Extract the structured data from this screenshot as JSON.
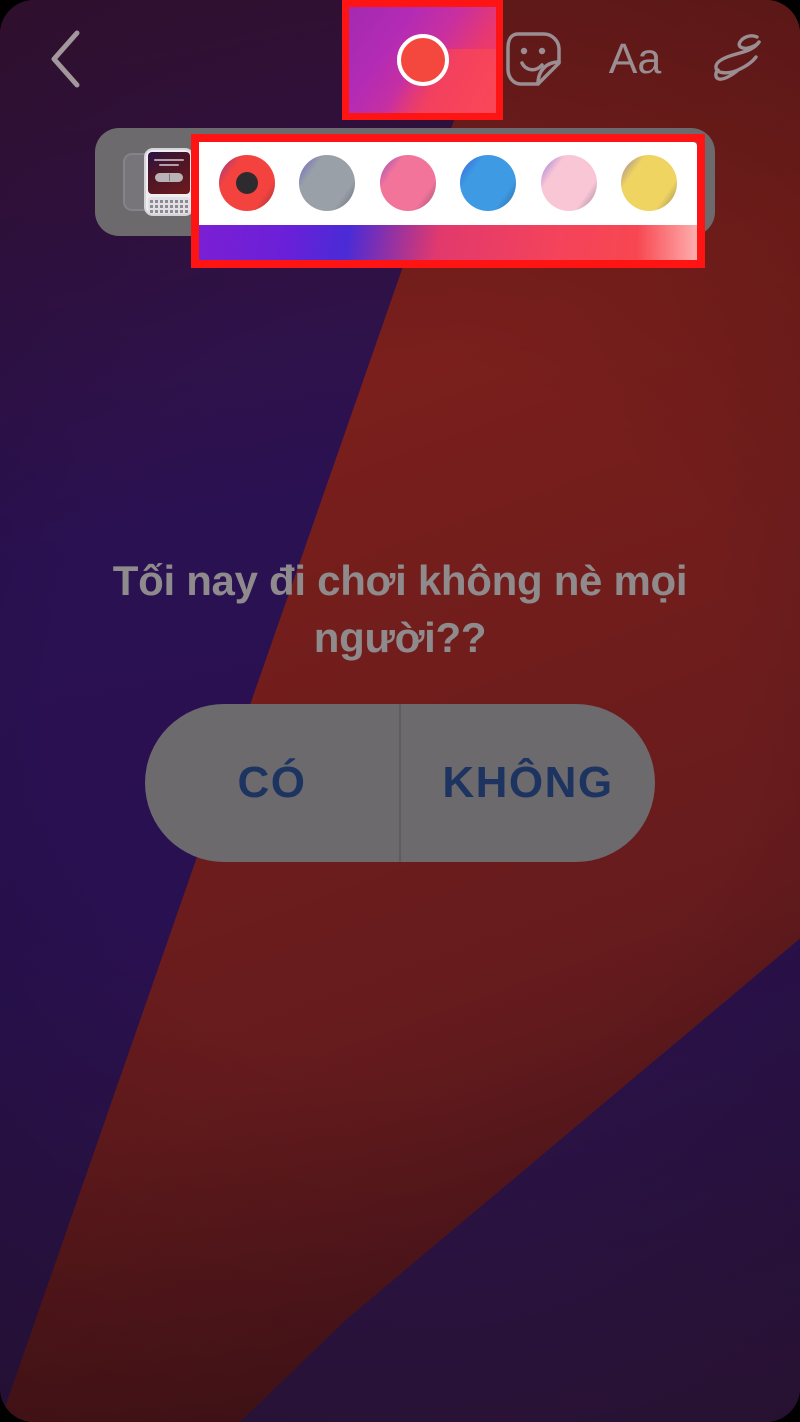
{
  "screen": {
    "app": "instagram-story-editor",
    "background": {
      "purple_hex": "#2a1152",
      "maroon_hex": "#751d1b",
      "canvas_radius_px": 34
    }
  },
  "toolbar": {
    "back_label": "back-chevron",
    "items": [
      {
        "name": "back",
        "icon": "chevron-left-icon",
        "label": ""
      },
      {
        "name": "color",
        "icon": "color-circle-icon",
        "label": "",
        "selected": true,
        "highlighted": true
      },
      {
        "name": "sticker",
        "icon": "sticker-face-icon",
        "label": ""
      },
      {
        "name": "text",
        "icon": "text-icon",
        "label": "Aa"
      },
      {
        "name": "draw",
        "icon": "scribble-draw-icon",
        "label": ""
      }
    ],
    "color_button": {
      "gradient_from": "#a42ab0",
      "gradient_to": "#f6425a",
      "dot_hex": "#f4483f",
      "ring_hex": "#ffffff"
    },
    "highlight_color": "#ff1414"
  },
  "swatch_tray": {
    "panel_hex": "#6c6a6c",
    "strip_bg": "#ffffff",
    "highlight_color": "#ff1414",
    "thumbnail_label": "story-thumbnail-preview",
    "swatches": [
      {
        "name": "red",
        "hex": "#f4433f",
        "selected": true,
        "dot_hex": "#2e2b2e"
      },
      {
        "name": "gray",
        "hex": "#9aa0a8",
        "selected": false
      },
      {
        "name": "pink",
        "hex": "#f2749b",
        "selected": false
      },
      {
        "name": "blue",
        "hex": "#3d9ae3",
        "selected": false
      },
      {
        "name": "light-pink",
        "hex": "#f9c6d6",
        "selected": false
      },
      {
        "name": "yellow",
        "hex": "#efd461",
        "selected": false
      }
    ],
    "strip_gradient_from": "#7b1fd4",
    "strip_gradient_to": "#fb4a4a"
  },
  "poll": {
    "question": "Tối nay đi chơi không nè mọi người??",
    "question_color": "#8f8b8d",
    "pill_hex": "#6c6a6c",
    "option_text_color": "#1d3461",
    "options": [
      {
        "label": "CÓ"
      },
      {
        "label": "KHÔNG"
      }
    ]
  }
}
